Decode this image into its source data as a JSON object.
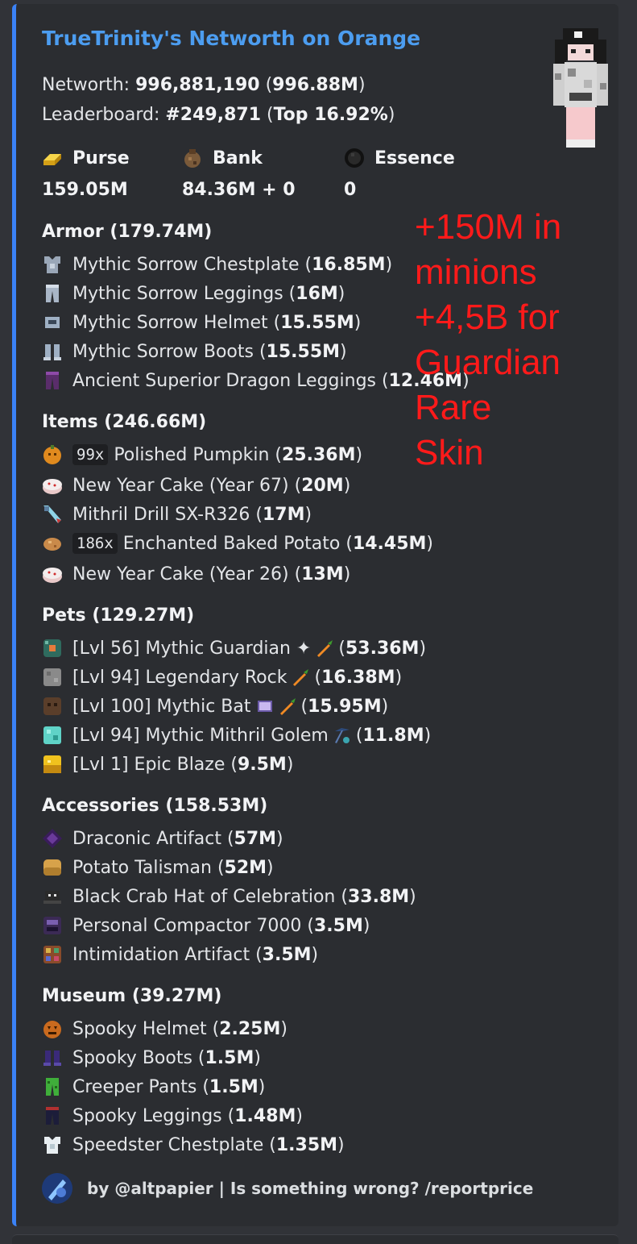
{
  "embed": {
    "title": "TrueTrinity's Networth on Orange",
    "networth_label": "Networth: ",
    "networth_value": "996,881,190",
    "networth_short": " (996.88M)",
    "leaderboard_label": "Leaderboard: ",
    "leaderboard_rank": "#249,871",
    "leaderboard_top": "(Top 16.92%)",
    "leaderboard_close": ")",
    "leaderboard_open": " ("
  },
  "fields": [
    {
      "name": "Purse",
      "value": "159.05M",
      "icon": "gold-ingot-icon"
    },
    {
      "name": "Bank",
      "value": "84.36M + 0",
      "icon": "bank-bag-icon"
    },
    {
      "name": "Essence",
      "value": "0",
      "icon": "essence-icon"
    }
  ],
  "sections": {
    "armor": {
      "title": "Armor (179.74M)",
      "items": [
        {
          "name": "Mythic Sorrow Chestplate",
          "price": "16.85M",
          "icon": "chestplate-icon"
        },
        {
          "name": "Mythic Sorrow Leggings",
          "price": "16M",
          "icon": "leggings-icon"
        },
        {
          "name": "Mythic Sorrow Helmet",
          "price": "15.55M",
          "icon": "helmet-icon"
        },
        {
          "name": "Mythic Sorrow Boots",
          "price": "15.55M",
          "icon": "boots-icon"
        },
        {
          "name": "Ancient Superior Dragon Leggings",
          "price": "12.46M",
          "icon": "dragon-leggings-icon"
        }
      ]
    },
    "items": {
      "title": "Items (246.66M)",
      "items": [
        {
          "count": "99x",
          "name": "Polished Pumpkin",
          "price": "25.36M",
          "icon": "pumpkin-icon"
        },
        {
          "count": "",
          "name": "New Year Cake (Year 67)",
          "price": "20M",
          "icon": "cake-icon"
        },
        {
          "count": "",
          "name": "Mithril Drill SX-R326",
          "price": "17M",
          "icon": "drill-icon"
        },
        {
          "count": "186x",
          "name": "Enchanted Baked Potato",
          "price": "14.45M",
          "icon": "baked-potato-icon"
        },
        {
          "count": "",
          "name": "New Year Cake (Year 26)",
          "price": "13M",
          "icon": "cake-icon"
        }
      ]
    },
    "pets": {
      "title": "Pets (129.27M)",
      "items": [
        {
          "name": "[Lvl 56] Mythic Guardian ✦",
          "price": "53.36M",
          "icon": "guardian-icon",
          "extra": [
            "carrot-icon"
          ]
        },
        {
          "name": "[Lvl 94] Legendary Rock",
          "price": "16.38M",
          "icon": "rock-icon",
          "extra": [
            "carrot-icon"
          ]
        },
        {
          "name": "[Lvl 100] Mythic Bat",
          "price": "15.95M",
          "icon": "bat-icon",
          "extra": [
            "book-icon",
            "carrot-icon"
          ]
        },
        {
          "name": "[Lvl 94] Mythic Mithril Golem",
          "price": "11.8M",
          "icon": "golem-icon",
          "extra": [
            "pickaxe-icon"
          ]
        },
        {
          "name": "[Lvl 1] Epic Blaze",
          "price": "9.5M",
          "icon": "blaze-icon",
          "extra": []
        }
      ]
    },
    "accessories": {
      "title": "Accessories (158.53M)",
      "items": [
        {
          "name": "Draconic Artifact",
          "price": "57M",
          "icon": "draconic-artifact-icon"
        },
        {
          "name": "Potato Talisman",
          "price": "52M",
          "icon": "potato-talisman-icon"
        },
        {
          "name": "Black Crab Hat of Celebration",
          "price": "33.8M",
          "icon": "crab-hat-icon"
        },
        {
          "name": "Personal Compactor 7000",
          "price": "3.5M",
          "icon": "compactor-icon"
        },
        {
          "name": "Intimidation Artifact",
          "price": "3.5M",
          "icon": "intimidation-artifact-icon"
        }
      ]
    },
    "museum": {
      "title": "Museum (39.27M)",
      "items": [
        {
          "name": "Spooky Helmet",
          "price": "2.25M",
          "icon": "spooky-helmet-icon"
        },
        {
          "name": "Spooky Boots",
          "price": "1.5M",
          "icon": "spooky-boots-icon"
        },
        {
          "name": "Creeper Pants",
          "price": "1.5M",
          "icon": "creeper-pants-icon"
        },
        {
          "name": "Spooky Leggings",
          "price": "1.48M",
          "icon": "spooky-leggings-icon"
        },
        {
          "name": "Speedster Chestplate",
          "price": "1.35M",
          "icon": "speedster-chestplate-icon"
        }
      ]
    }
  },
  "footer": {
    "text": "by @altpapier | Is something wrong? /reportprice"
  },
  "annotation": {
    "lines": [
      "+150M in",
      "minions",
      "+4,5B for",
      "Guardian",
      "Rare",
      "Skin"
    ],
    "color": "#ff1a1a"
  },
  "colors": {
    "accent": "#3b82f6",
    "title": "#4c9df0",
    "embed_bg": "#2b2d31",
    "page_bg": "#313338"
  }
}
